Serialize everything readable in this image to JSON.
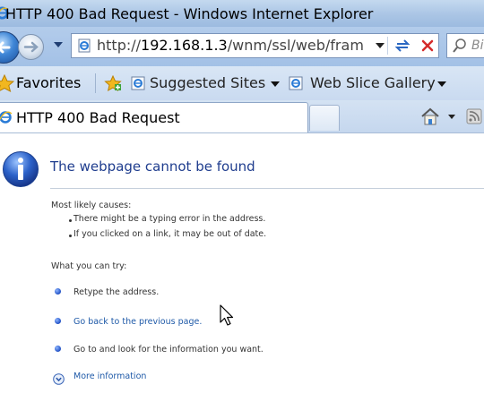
{
  "window": {
    "title": "HTTP 400 Bad Request - Windows Internet Explorer"
  },
  "address_bar": {
    "url_prefix": "http://",
    "url_host": "192.168.1.3",
    "url_rest": "/wnm/ssl/web/fram",
    "search_placeholder": "Bi"
  },
  "favorites_bar": {
    "favorites_label": "Favorites",
    "suggested_sites_label": "Suggested Sites",
    "web_slice_gallery_label": "Web Slice Gallery"
  },
  "tabs": [
    {
      "title": "HTTP 400 Bad Request",
      "active": true
    }
  ],
  "page": {
    "heading": "The webpage cannot be found",
    "causes_heading": "Most likely causes:",
    "causes": [
      "There might be a typing error in the address.",
      "If you clicked on a link, it may be out of date."
    ],
    "try_heading": "What you can try:",
    "try_items": [
      "Retype the address.",
      "Go back to the previous page.",
      "Go to  and look for the information you want."
    ],
    "more_info": "More information"
  },
  "colors": {
    "chrome_blue": "#aac5e5",
    "heading_blue": "#1f3d8e",
    "link_blue": "#1f5aa8"
  }
}
